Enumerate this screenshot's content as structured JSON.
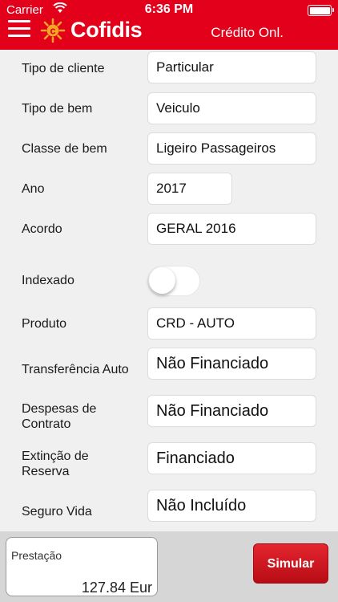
{
  "status_bar": {
    "carrier": "Carrier",
    "time": "6:36 PM"
  },
  "header": {
    "brand": "Cofidis",
    "logo_letter": "c",
    "title": "Crédito Onl.",
    "brand_color": "#e3001b"
  },
  "form": {
    "tipo_cliente": {
      "label": "Tipo de cliente",
      "value": "Particular"
    },
    "tipo_bem": {
      "label": "Tipo de bem",
      "value": "Veiculo"
    },
    "classe_bem": {
      "label": "Classe de bem",
      "value": "Ligeiro Passageiros"
    },
    "ano": {
      "label": "Ano",
      "value": "2017"
    },
    "acordo": {
      "label": "Acordo",
      "value": "GERAL 2016"
    },
    "indexado": {
      "label": "Indexado",
      "on": false
    },
    "produto": {
      "label": "Produto",
      "value": "CRD - AUTO"
    },
    "transferencia_auto": {
      "label": "Transferência Auto",
      "value": "Não Financiado"
    },
    "despesas_contrato": {
      "label_line1": "Despesas de",
      "label_line2": "Contrato",
      "value": "Não Financiado"
    },
    "extincao_reserva": {
      "label_line1": "Extinção de",
      "label_line2": "Reserva",
      "value": "Financiado"
    },
    "seguro_vida": {
      "label": "Seguro Vida",
      "value": "Não Incluído"
    }
  },
  "footer": {
    "prestacao_label": "Prestação",
    "prestacao_value": "127.84 Eur",
    "simular_label": "Simular"
  }
}
